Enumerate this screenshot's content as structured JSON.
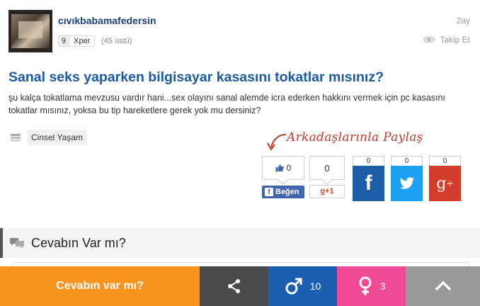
{
  "user": {
    "name": "cıvıkbabamafedersin",
    "time": "2ay",
    "level_num": "9",
    "level_rank": "Xper",
    "rank_note": "(45 üstü)",
    "follow": "Takip Et"
  },
  "question": {
    "title": "Sanal seks yaparken bilgisayar kasasını tokatlar mısınız?",
    "body": "şu kalça tokatlama mevzusu vardır hani...sex olayını sanal alemde icra ederken hakkını vermek için pc kasasını tokatlar mısınız, yoksa bu tip hareketlere gerek yok mu dersiniz?",
    "category": "Cinsel Yaşam"
  },
  "share": {
    "hint": "Arkadaşlarınla Paylaş",
    "like_count": "0",
    "like_label": "Beğen",
    "gplus_count": "0",
    "gplus_label": "g+1",
    "facebook_count": "0",
    "twitter_count": "0",
    "googleplus_count": "0",
    "colors": {
      "facebook": "#1d5ea8",
      "twitter": "#1da1f2",
      "googleplus": "#d43c2c"
    }
  },
  "answer_section": {
    "title": "Cevabın Var mı?"
  },
  "bottom_bar": {
    "answer_label": "Cevabın var mı?",
    "male_count": "10",
    "female_count": "3",
    "colors": {
      "answer": "#f7931e",
      "share": "#4a4a4a",
      "male": "#1b5fb0",
      "female": "#f04a95",
      "up": "#999999"
    },
    "icons": [
      "share-icon",
      "male-icon",
      "female-icon",
      "chevron-up-icon"
    ]
  }
}
